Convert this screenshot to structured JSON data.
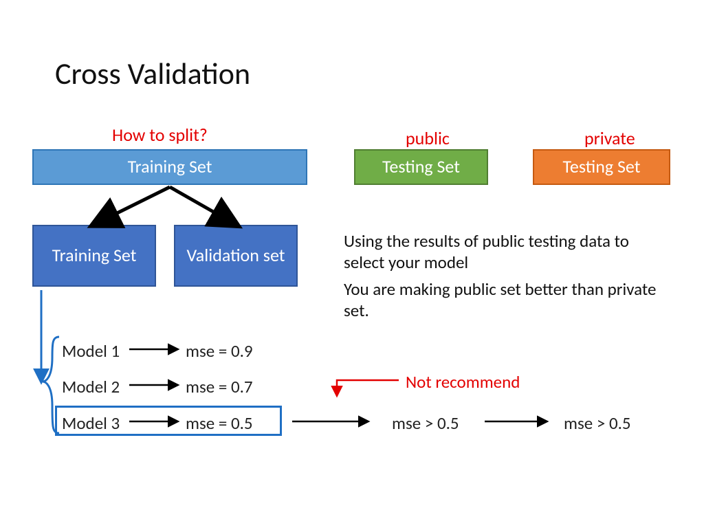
{
  "title": "Cross Validation",
  "labels": {
    "how_to_split": "How to split?",
    "public": "public",
    "private": "private",
    "not_recommend": "Not recommend"
  },
  "boxes": {
    "training_top": "Training Set",
    "training_sub": "Training Set",
    "validation": "Validation set",
    "testing_public": "Testing Set",
    "testing_private": "Testing Set"
  },
  "text": {
    "line1": "Using the results of public testing data to select your model",
    "line2": "You are making public set better than private set."
  },
  "models": {
    "m1_label": "Model 1",
    "m1_mse": "mse = 0.9",
    "m2_label": "Model 2",
    "m2_mse": "mse = 0.7",
    "m3_label": "Model 3",
    "m3_mse": "mse = 0.5",
    "public_result": "mse > 0.5",
    "private_result": "mse > 0.5"
  },
  "colors": {
    "red": "#e30000",
    "blue_arrow": "#1f6fc4",
    "black": "#000000"
  }
}
